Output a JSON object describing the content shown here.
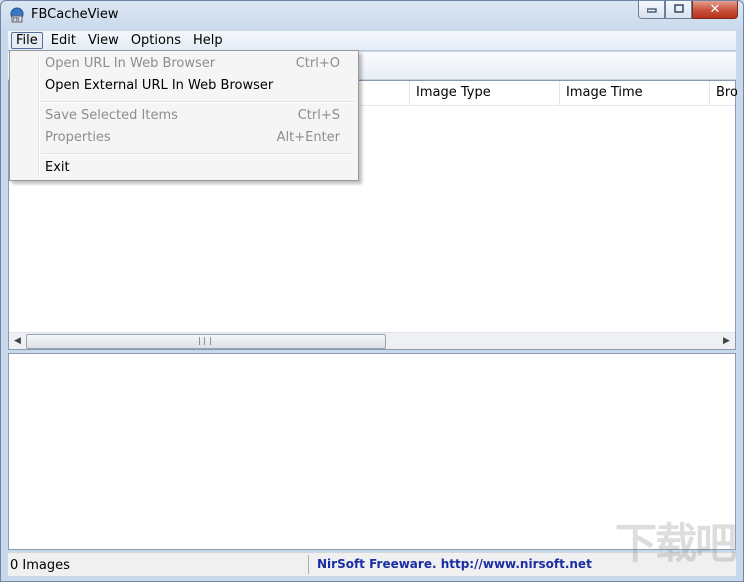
{
  "window": {
    "title": "FBCacheView",
    "caption_buttons": {
      "minimize": "▭",
      "maximize": "□",
      "close": "✕"
    }
  },
  "menubar": {
    "items": [
      {
        "label": "File",
        "active": true
      },
      {
        "label": "Edit"
      },
      {
        "label": "View"
      },
      {
        "label": "Options"
      },
      {
        "label": "Help"
      }
    ]
  },
  "file_menu": {
    "items": [
      {
        "label": "Open URL In Web Browser",
        "shortcut": "Ctrl+O",
        "enabled": false
      },
      {
        "label": "Open External URL In Web Browser",
        "shortcut": "",
        "enabled": true
      },
      {
        "label": "Save Selected Items",
        "shortcut": "Ctrl+S",
        "enabled": false
      },
      {
        "label": "Properties",
        "shortcut": "Alt+Enter",
        "enabled": false
      },
      {
        "label": "Exit",
        "shortcut": "",
        "enabled": true
      }
    ]
  },
  "listview": {
    "columns": [
      "Image Type",
      "Image Time",
      "Bro"
    ]
  },
  "scrollbar": {
    "left_arrow": "◀",
    "right_arrow": "▶"
  },
  "statusbar": {
    "count": "0 Images",
    "link": "NirSoft Freeware.  http://www.nirsoft.net"
  },
  "watermark": "下载吧",
  "icons": [
    "app-icon",
    "minimize-icon",
    "maximize-icon",
    "close-icon",
    "scroll-left-icon",
    "scroll-right-icon"
  ]
}
